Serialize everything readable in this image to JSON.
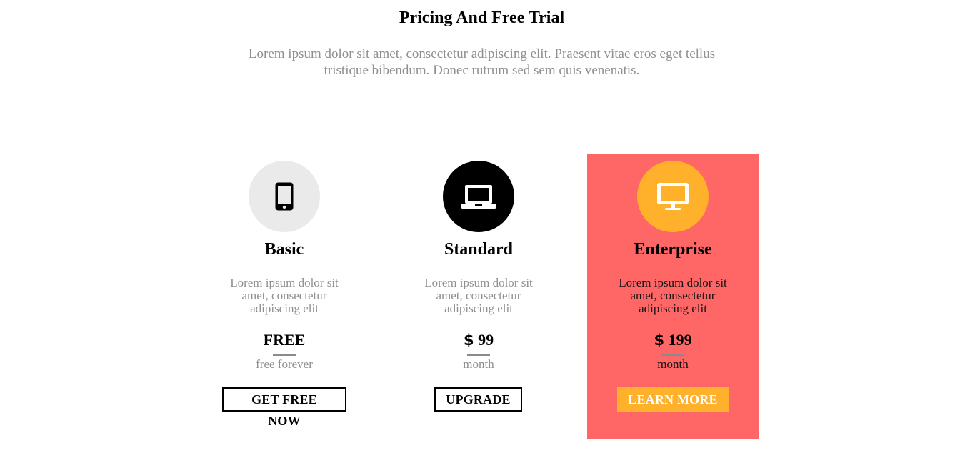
{
  "page": {
    "title": "Pricing And Free Trial",
    "description": "Lorem ipsum dolor sit amet, consectetur adipiscing elit. Praesent vitae eros eget tellus tristique bibendum. Donec rutrum sed sem quis venenatis."
  },
  "colors": {
    "highlight_card_bg": "#ff6666",
    "accent": "#ffb12b",
    "muted_text": "#8f8f8f",
    "basic_icon_bg": "#eaeaea",
    "standard_icon_bg": "#000000"
  },
  "plans": [
    {
      "name": "Basic",
      "icon": "mobile-phone-icon",
      "description": "Lorem ipsum dolor sit amet, consectetur adipiscing elit",
      "currency": "",
      "price": "FREE",
      "period": "free forever",
      "button_label": "GET FREE NOW"
    },
    {
      "name": "Standard",
      "icon": "laptop-icon",
      "description": "Lorem ipsum dolor sit amet, consectetur adipiscing elit",
      "currency": "$",
      "price": "99",
      "period": "month",
      "button_label": "UPGRADE"
    },
    {
      "name": "Enterprise",
      "icon": "desktop-monitor-icon",
      "description": "Lorem ipsum dolor sit amet, consectetur adipiscing elit",
      "currency": "$",
      "price": "199",
      "period": "month",
      "button_label": "LEARN MORE",
      "highlighted": true
    }
  ]
}
